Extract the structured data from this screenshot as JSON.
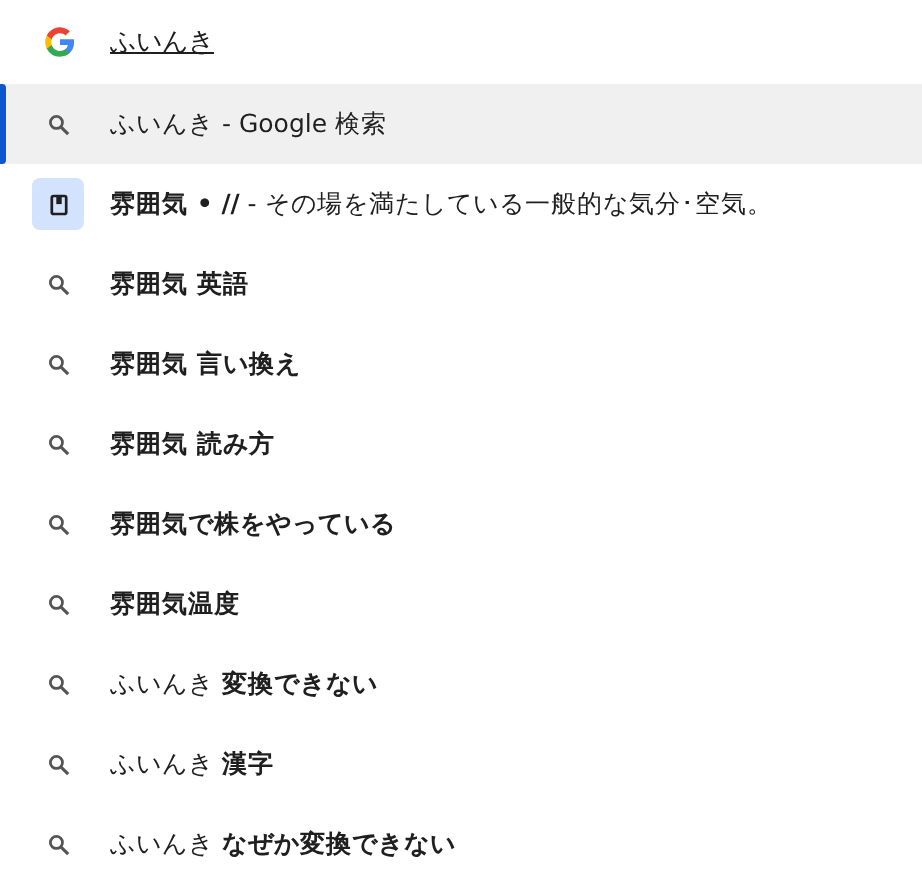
{
  "search": {
    "value": "ふいんき"
  },
  "suggestions": [
    {
      "kind": "search",
      "text": "ふいんき - Google 検索",
      "selected": true
    },
    {
      "kind": "entity",
      "text": "**雰囲気 • //** - その場を満たしている一般的な気分･空気。",
      "selected": false
    },
    {
      "kind": "search",
      "text": "**雰囲気 英語**",
      "selected": false
    },
    {
      "kind": "search",
      "text": "**雰囲気 言い換え**",
      "selected": false
    },
    {
      "kind": "search",
      "text": "**雰囲気 読み方**",
      "selected": false
    },
    {
      "kind": "search",
      "text": "**雰囲気で株をやっている**",
      "selected": false
    },
    {
      "kind": "search",
      "text": "**雰囲気温度**",
      "selected": false
    },
    {
      "kind": "search",
      "text": "ふいんき **変換できない**",
      "selected": false
    },
    {
      "kind": "search",
      "text": "ふいんき **漢字**",
      "selected": false
    },
    {
      "kind": "search",
      "text": "ふいんき **なぜか変換できない**",
      "selected": false
    }
  ]
}
